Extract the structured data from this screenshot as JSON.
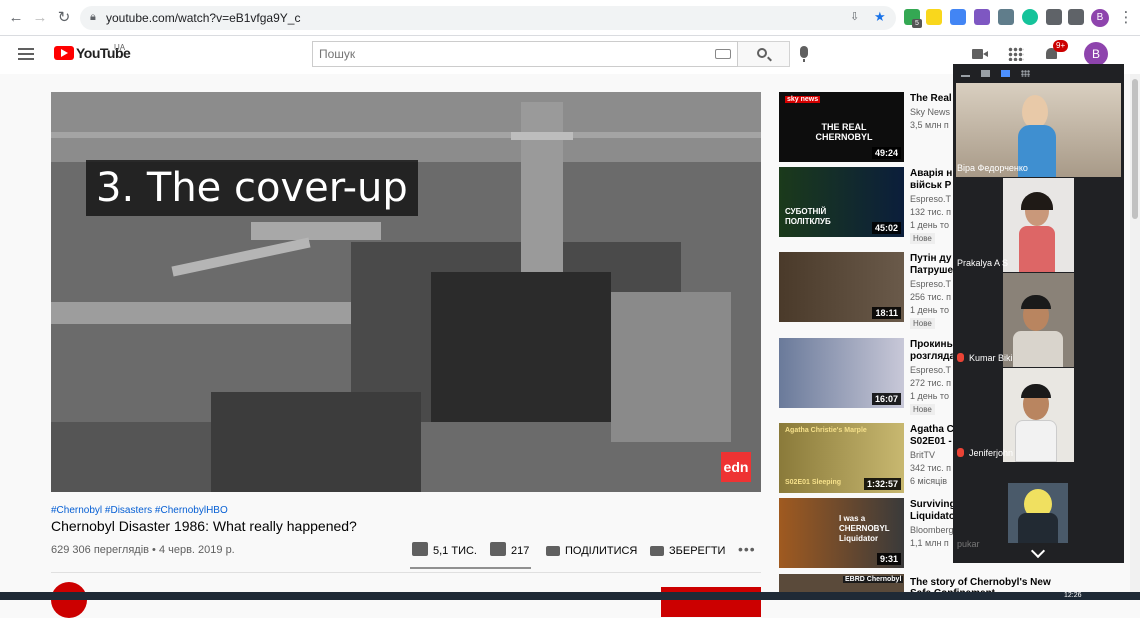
{
  "browser": {
    "url": "youtube.com/watch?v=eB1vfga9Y_c",
    "profile_initial": "B",
    "extension_badge": "5"
  },
  "header": {
    "logo_text": "YouTube",
    "region": "UA",
    "search_placeholder": "Пошук",
    "notification_count": "9+",
    "avatar_initial": "B"
  },
  "video": {
    "overlay_caption": "3. The cover-up",
    "watermark": "edn",
    "hashtags": "#Chernobyl #Disasters #ChernobylHBO",
    "title": "Chernobyl Disaster 1986: What really happened?",
    "meta": "629 306 переглядів • 4 черв. 2019 р.",
    "likes": "5,1 ТИС.",
    "dislikes": "217",
    "share_label": "ПОДІЛИТИСЯ",
    "save_label": "ЗБЕРЕГТИ"
  },
  "recommendations": [
    {
      "title": "The Real",
      "lines": [
        "Sky News",
        "3,5 млн п"
      ],
      "duration": "49:24",
      "new": "",
      "thumb_text": "THE REAL CHERNOBYL",
      "thumb_badge": "sky news"
    },
    {
      "title": "Аварія н",
      "title2": "військ Р",
      "lines": [
        "Espreso.T",
        "132 тис. п",
        "1 день то"
      ],
      "duration": "45:02",
      "new": "Нове",
      "thumb_text": "СУБОТНІЙ ПОЛІТКЛУБ"
    },
    {
      "title": "Путін ду",
      "title2": "Патруше",
      "lines": [
        "Espreso.T",
        "256 тис. п",
        "1 день то"
      ],
      "duration": "18:11",
      "new": "Нове"
    },
    {
      "title": "Прокинь",
      "title2": "розгляда",
      "lines": [
        "Espreso.T",
        "272 тис. п",
        "1 день то"
      ],
      "duration": "16:07",
      "new": "Нове"
    },
    {
      "title": "Agatha C",
      "title2": "S02E01 -",
      "lines": [
        "BritTV",
        "342 тис. п",
        "6 місяців"
      ],
      "duration": "1:32:57",
      "new": "",
      "thumb_text": "Agatha Christie's Marple",
      "thumb_sub": "S02E01 Sleeping"
    },
    {
      "title": "Surviving",
      "title2": "Liquidato",
      "lines": [
        "Bloomberg",
        "1,1 млн п"
      ],
      "duration": "9:31",
      "new": "",
      "thumb_text": "I was a CHERNOBYL Liquidator"
    },
    {
      "title": "The story of Chernobyl's New",
      "title2": "Safe Confinement",
      "lines": [],
      "duration": "",
      "new": "",
      "thumb_text": "EBRD Chernobyl"
    }
  ],
  "meet": {
    "participants": [
      {
        "name": "Віра Федорченко",
        "muted": false
      },
      {
        "name": "Prakalya A S",
        "muted": false
      },
      {
        "name": "Kumar Biki",
        "muted": true
      },
      {
        "name": "Jeniferjohn",
        "muted": true
      },
      {
        "name": "pukar",
        "muted": false
      }
    ]
  },
  "taskbar": {
    "time": "12:26"
  },
  "colors": {
    "yt_red": "#ff0000",
    "link_blue": "#065fd4",
    "meet_bg": "#202124",
    "avatar_purple": "#8e44ad"
  }
}
